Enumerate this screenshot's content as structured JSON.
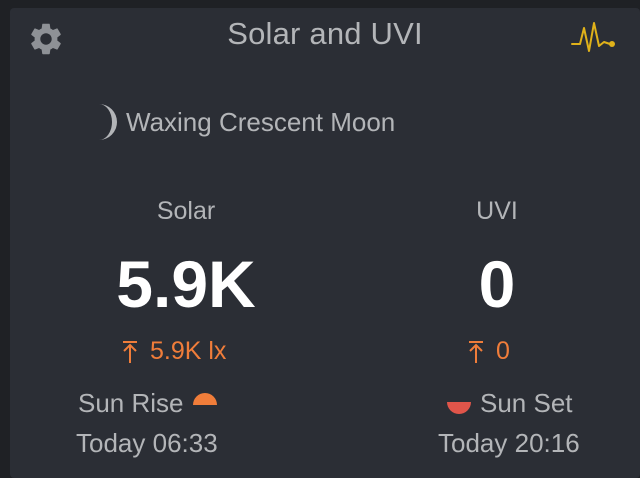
{
  "card": {
    "title": "Solar and UVI"
  },
  "moon": {
    "phase": "Waxing Crescent Moon",
    "icon": "waxing-crescent-moon-icon"
  },
  "solar": {
    "label": "Solar",
    "value": "5.9K",
    "max": "5.9K lx"
  },
  "uvi": {
    "label": "UVI",
    "value": "0",
    "max": "0"
  },
  "sunrise": {
    "label": "Sun Rise",
    "time": "Today 06:33"
  },
  "sunset": {
    "label": "Sun Set",
    "time": "Today 20:16"
  },
  "colors": {
    "accent_orange": "#f07d3a",
    "graph_icon_yellow": "#e0b21a",
    "sunset_red": "#e0554a",
    "card_bg": "#2b2e35",
    "page_bg": "#1f2125"
  },
  "icons": {
    "settings": "gear-icon",
    "history": "graph-pulse-icon",
    "max_marker": "arrow-up-to-bar-icon",
    "sunrise": "sunrise-half-sun-icon",
    "sunset": "sunset-half-sun-icon"
  }
}
